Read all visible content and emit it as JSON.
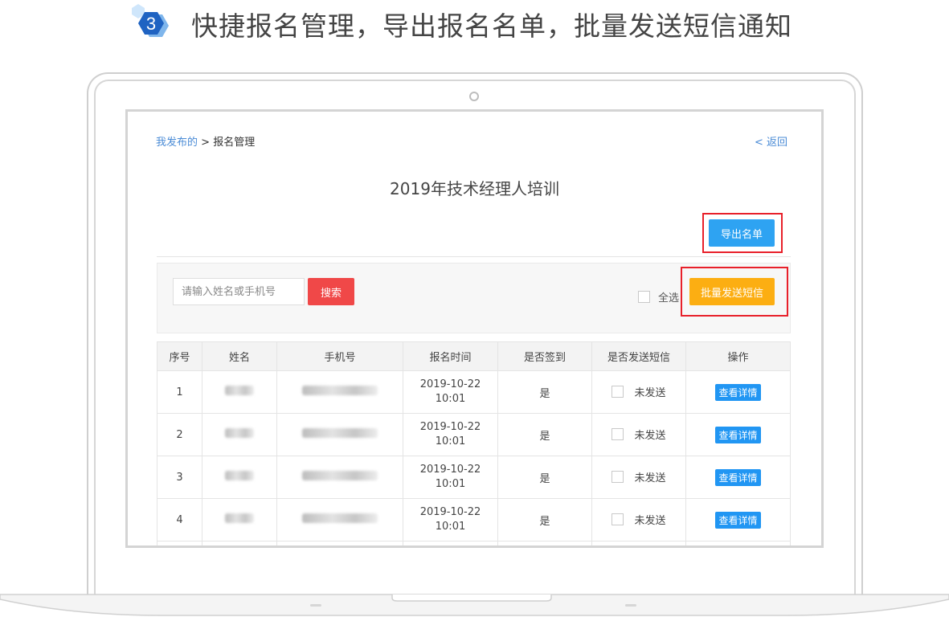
{
  "step": {
    "number": "3"
  },
  "headline": "快捷报名管理，导出报名名单，批量发送短信通知",
  "breadcrumb": {
    "parent": "我发布的",
    "separator": " > ",
    "current": "报名管理"
  },
  "back_label": "< 返回",
  "page_title": "2019年技术经理人培训",
  "toolbar": {
    "export_label": "导出名单"
  },
  "filter": {
    "search_placeholder": "请输入姓名或手机号",
    "search_label": "搜索",
    "select_all_label": "全选",
    "bulk_sms_label": "批量发送短信"
  },
  "table": {
    "columns": [
      "序号",
      "姓名",
      "手机号",
      "报名时间",
      "是否签到",
      "是否发送短信",
      "操作"
    ],
    "rows": [
      {
        "index": "1",
        "date": "2019-10-22",
        "time": "10:01",
        "checked_in": "是",
        "sms_status": "未发送",
        "action": "查看详情"
      },
      {
        "index": "2",
        "date": "2019-10-22",
        "time": "10:01",
        "checked_in": "是",
        "sms_status": "未发送",
        "action": "查看详情"
      },
      {
        "index": "3",
        "date": "2019-10-22",
        "time": "10:01",
        "checked_in": "是",
        "sms_status": "未发送",
        "action": "查看详情"
      },
      {
        "index": "4",
        "date": "2019-10-22",
        "time": "10:01",
        "checked_in": "是",
        "sms_status": "未发送",
        "action": "查看详情"
      }
    ]
  },
  "colors": {
    "primary_blue": "#2ea3f2",
    "search_red": "#f04848",
    "bulk_orange": "#fcae12",
    "highlight_red": "#e8202a",
    "link_blue": "#4a8bd6"
  }
}
